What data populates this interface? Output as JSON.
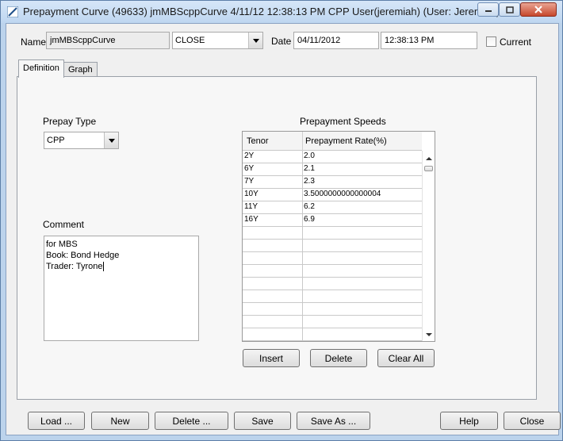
{
  "window": {
    "title": "Prepayment Curve (49633) jmMBScppCurve 4/11/12 12:38:13 PM  CPP User(jeremiah) (User: Jeremiah)"
  },
  "header": {
    "name_label": "Name",
    "name_value": "jmMBScppCurve",
    "type_value": "CLOSE",
    "date_label": "Date",
    "date_value": "04/11/2012",
    "time_value": "12:38:13 PM",
    "current_label": "Current",
    "current_checked": false
  },
  "tabs": [
    {
      "label": "Definition",
      "active": true
    },
    {
      "label": "Graph",
      "active": false
    }
  ],
  "definition": {
    "prepay_type_label": "Prepay Type",
    "prepay_type_value": "CPP",
    "comment_label": "Comment",
    "comment_lines": [
      "for MBS",
      "Book: Bond Hedge",
      "Trader: Tyrone"
    ],
    "speeds_label": "Prepayment Speeds",
    "columns": [
      "Tenor",
      "Prepayment Rate(%)"
    ],
    "rows": [
      {
        "tenor": "2Y",
        "rate": "2.0"
      },
      {
        "tenor": "6Y",
        "rate": "2.1"
      },
      {
        "tenor": "7Y",
        "rate": "2.3"
      },
      {
        "tenor": "10Y",
        "rate": "3.5000000000000004"
      },
      {
        "tenor": "11Y",
        "rate": "6.2"
      },
      {
        "tenor": "16Y",
        "rate": "6.9"
      }
    ],
    "empty_rows": 9,
    "insert_label": "Insert",
    "delete_label": "Delete",
    "clear_all_label": "Clear All"
  },
  "footer": {
    "load_label": "Load ...",
    "new_label": "New",
    "delete_label": "Delete ...",
    "save_label": "Save",
    "save_as_label": "Save As ...",
    "help_label": "Help",
    "close_label": "Close"
  },
  "colors": {
    "titlebar": "#bed6f0",
    "client": "#f0f0f0",
    "close_button": "#c7472c"
  },
  "icons": {
    "app": "app-curve-icon",
    "minimize": "minimize-icon",
    "maximize": "maximize-icon",
    "close": "close-icon",
    "dropdown": "chevron-down-icon"
  }
}
